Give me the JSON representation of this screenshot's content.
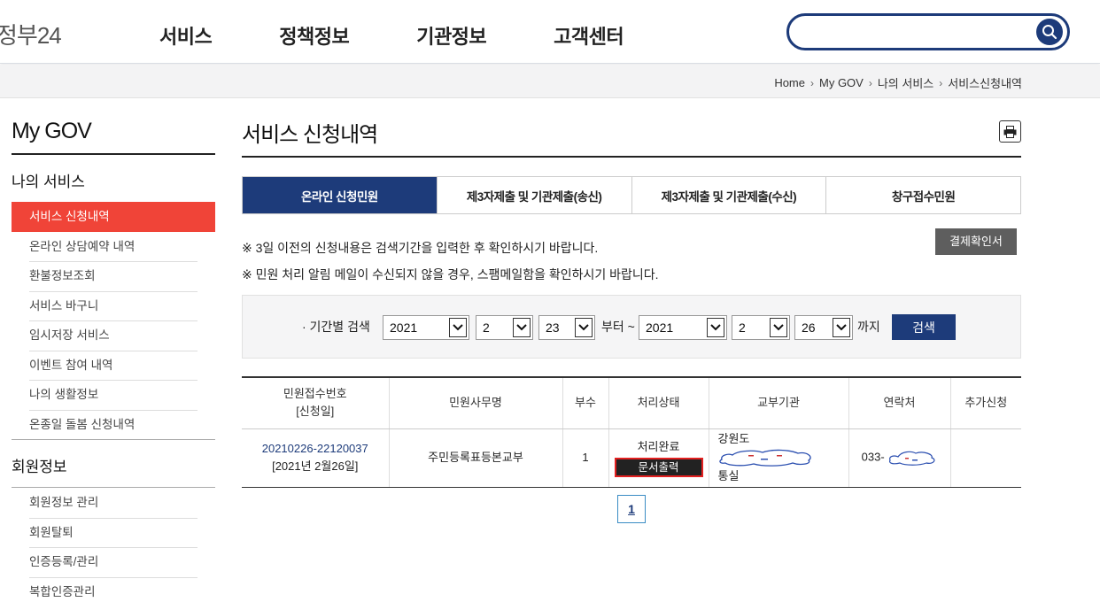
{
  "header": {
    "logo": "정부24",
    "nav": [
      "서비스",
      "정책정보",
      "기관정보",
      "고객센터"
    ],
    "search_placeholder": ""
  },
  "breadcrumb": [
    "Home",
    "My GOV",
    "나의 서비스",
    "서비스신청내역"
  ],
  "sidebar": {
    "title": "My GOV",
    "group1": "나의 서비스",
    "items1": [
      "서비스 신청내역",
      "온라인 상담예약 내역",
      "환불정보조회",
      "서비스 바구니",
      "임시저장 서비스",
      "이벤트 참여 내역",
      "나의 생활정보",
      "온종일 돌봄 신청내역"
    ],
    "group2": "회원정보",
    "items2": [
      "회원정보 관리",
      "회원탈퇴",
      "인증등록/관리",
      "복합인증관리"
    ]
  },
  "main": {
    "title": "서비스 신청내역",
    "tabs": [
      "온라인 신청민원",
      "제3자제출 및 기관제출(송신)",
      "제3자제출 및 기관제출(수신)",
      "창구접수민원"
    ],
    "notice1": "※ 3일 이전의 신청내용은 검색기간을 입력한 후 확인하시기 바랍니다.",
    "notice2": "※ 민원 처리 알림 메일이 수신되지 않을 경우, 스팸메일함을 확인하시기 바랍니다.",
    "receipt_button": "결제확인서",
    "filter": {
      "label": "· 기간별 검색",
      "from_year": "2021",
      "from_month": "2",
      "from_day": "23",
      "from_text": "부터 ~",
      "to_year": "2021",
      "to_month": "2",
      "to_day": "26",
      "to_text": "까지",
      "search_button": "검색"
    },
    "table": {
      "headers": {
        "no_line1": "민원접수번호",
        "no_line2": "[신청일]",
        "name": "민원사무명",
        "copies": "부수",
        "status": "처리상태",
        "org": "교부기관",
        "contact": "연락처",
        "extra": "추가신청"
      },
      "row": {
        "no": "20210226-22120037",
        "date": "[2021년 2월26일]",
        "name": "주민등록표등본교부",
        "copies": "1",
        "status": "처리완료",
        "print_button": "문서출력",
        "org_prefix": "강원도",
        "org_suffix": "통실",
        "contact_prefix": "033-",
        "extra": ""
      }
    },
    "pagination": [
      "1"
    ]
  },
  "colors": {
    "primary": "#1d3b7a",
    "active_menu": "#f04438",
    "receipt_btn": "#5e5e5e"
  }
}
